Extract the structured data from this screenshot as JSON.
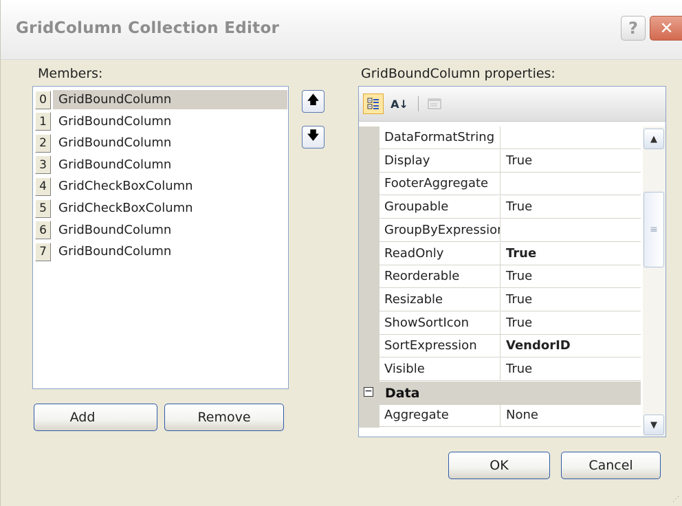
{
  "window": {
    "title": "GridColumn Collection Editor",
    "help_label": "?",
    "close_label": "✕"
  },
  "members": {
    "label": "Members:",
    "items": [
      {
        "index": "0",
        "name": "GridBoundColumn"
      },
      {
        "index": "1",
        "name": "GridBoundColumn"
      },
      {
        "index": "2",
        "name": "GridBoundColumn"
      },
      {
        "index": "3",
        "name": "GridBoundColumn"
      },
      {
        "index": "4",
        "name": "GridCheckBoxColumn"
      },
      {
        "index": "5",
        "name": "GridCheckBoxColumn"
      },
      {
        "index": "6",
        "name": "GridBoundColumn"
      },
      {
        "index": "7",
        "name": "GridBoundColumn"
      }
    ],
    "selected_index": 0,
    "move_up": "🡅",
    "move_down": "🡇"
  },
  "buttons": {
    "add": "Add",
    "add_dropdown": "▼",
    "remove": "Remove",
    "ok": "OK",
    "cancel": "Cancel"
  },
  "properties": {
    "label": "GridBoundColumn properties:",
    "toolbar": {
      "categorized_icon": "categorized-icon",
      "alphabetical_icon": "alphabetical-icon",
      "alphabetical_text": "A↓",
      "pages_icon": "property-pages-icon"
    },
    "rows": [
      {
        "name": "DataFormatString",
        "value": "",
        "bold": false
      },
      {
        "name": "Display",
        "value": "True",
        "bold": false
      },
      {
        "name": "FooterAggregate",
        "value": "",
        "bold": false
      },
      {
        "name": "Groupable",
        "value": "True",
        "bold": false
      },
      {
        "name": "GroupByExpression",
        "value": "",
        "bold": false
      },
      {
        "name": "ReadOnly",
        "value": "True",
        "bold": true
      },
      {
        "name": "Reorderable",
        "value": "True",
        "bold": false
      },
      {
        "name": "Resizable",
        "value": "True",
        "bold": false
      },
      {
        "name": "ShowSortIcon",
        "value": "True",
        "bold": false
      },
      {
        "name": "SortExpression",
        "value": "VendorID",
        "bold": true
      },
      {
        "name": "Visible",
        "value": "True",
        "bold": false
      }
    ],
    "category": {
      "toggle": "−",
      "label": "Data"
    },
    "data_rows": [
      {
        "name": "Aggregate",
        "value": "None",
        "bold": false
      }
    ],
    "scroll": {
      "up": "▲",
      "down": "▼",
      "thumb": "≡"
    }
  }
}
